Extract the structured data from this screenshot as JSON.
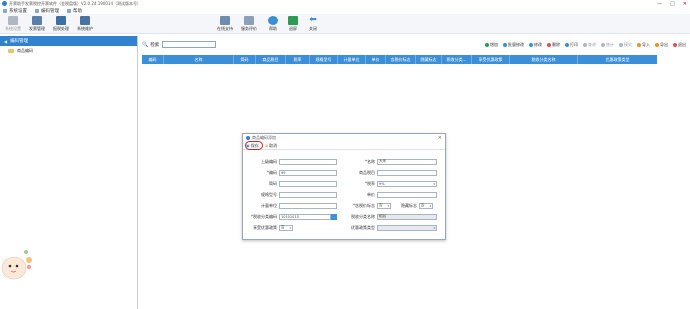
{
  "window": {
    "title": "开票助手发票税控开票软件（金税盘版）V2.0.24.190014（测试版本号）",
    "controls": [
      "—",
      "□",
      "✕"
    ]
  },
  "menu": [
    {
      "label": "系统设置",
      "icon": "gear-icon"
    },
    {
      "label": "编码管理",
      "icon": "code-icon"
    },
    {
      "label": "帮助",
      "icon": "help-icon"
    }
  ],
  "toolbar": {
    "items": [
      {
        "label": "系统设置",
        "icon": "settings-icon",
        "color": "#b0b7c3",
        "disabled": true
      },
      {
        "label": "发票管理",
        "icon": "invoice-icon",
        "color": "#5a7fa8",
        "disabled": false
      },
      {
        "label": "报税处理",
        "icon": "tax-icon",
        "color": "#3e6fa5",
        "disabled": false
      },
      {
        "label": "系统维护",
        "icon": "maintenance-icon",
        "color": "#4a73a0",
        "disabled": false
      },
      {
        "label": "在线支持",
        "icon": "support-icon",
        "color": "#6c8cb0",
        "disabled": false
      },
      {
        "label": "服务评价",
        "icon": "rating-icon",
        "color": "#8aa0bb",
        "disabled": false
      },
      {
        "label": "帮助",
        "icon": "help-icon",
        "color": "#3a8fd8",
        "disabled": false
      },
      {
        "label": "退屏",
        "icon": "screen-icon",
        "color": "#2e9a56",
        "disabled": false
      },
      {
        "label": "关闭",
        "icon": "back-arrow-icon",
        "color": "#3a8fd8",
        "disabled": false
      }
    ]
  },
  "sidebar": {
    "header": "编码管理",
    "items": [
      "商品编码"
    ]
  },
  "search": {
    "label": "检索",
    "placeholder": ""
  },
  "actions": [
    {
      "label": "增加",
      "icon": "add-icon",
      "color": "#2e9a56",
      "disabled": false
    },
    {
      "label": "批量修改",
      "icon": "batch-edit-icon",
      "color": "#3a8fd8",
      "disabled": false
    },
    {
      "label": "修改",
      "icon": "edit-icon",
      "color": "#3a8fd8",
      "disabled": false
    },
    {
      "label": "删除",
      "icon": "delete-icon",
      "color": "#d9534f",
      "disabled": false
    },
    {
      "label": "打印",
      "icon": "print-icon",
      "color": "#3a8fd8",
      "disabled": false
    },
    {
      "label": "查询",
      "icon": "query-icon",
      "color": "#b0b7c3",
      "disabled": true
    },
    {
      "label": "统计",
      "icon": "stats-icon",
      "color": "#b0b7c3",
      "disabled": true
    },
    {
      "label": "模式",
      "icon": "mode-icon",
      "color": "#b0b7c3",
      "disabled": true
    },
    {
      "label": "导入",
      "icon": "import-icon",
      "color": "#e8912d",
      "disabled": false
    },
    {
      "label": "导出",
      "icon": "export-icon",
      "color": "#e8912d",
      "disabled": false
    },
    {
      "label": "退出",
      "icon": "exit-icon",
      "color": "#d9534f",
      "disabled": false
    }
  ],
  "grid": {
    "columns": [
      "编码",
      "名称",
      "简码",
      "商品税目",
      "税率",
      "规格型号",
      "计量单位",
      "单价",
      "含税价标志",
      "隐藏标志",
      "税收分类...",
      "享受优惠政策",
      "税收分类名称",
      "优惠政策类型"
    ]
  },
  "dialog": {
    "title": "商品编码添加",
    "save_label": "保存",
    "cancel_label": "取消",
    "fields": {
      "parent_code": {
        "label": "上级编码",
        "value": ""
      },
      "name": {
        "label": "*名称",
        "value": "大米"
      },
      "code": {
        "label": "*编码",
        "value": "99"
      },
      "tax_item": {
        "label": "商品税目",
        "value": ""
      },
      "short_code": {
        "label": "简码",
        "value": ""
      },
      "tax_rate": {
        "label": "*税率",
        "value": "9%"
      },
      "spec": {
        "label": "规格型号",
        "value": ""
      },
      "unit_price": {
        "label": "单价",
        "value": ""
      },
      "unit": {
        "label": "计量单位",
        "value": ""
      },
      "incl_tax": {
        "label": "*含税价标志",
        "value": "否"
      },
      "hidden_flag": {
        "label": "隐藏标志",
        "value": "否"
      },
      "tax_class_code": {
        "label": "*税收分类编码",
        "value": "10101010"
      },
      "tax_class_name": {
        "label": "税收分类名称",
        "value": "稻谷"
      },
      "preferential": {
        "label": "享受优惠政策",
        "value": "否"
      },
      "preferential_type": {
        "label": "优惠政策类型",
        "value": ""
      }
    }
  }
}
